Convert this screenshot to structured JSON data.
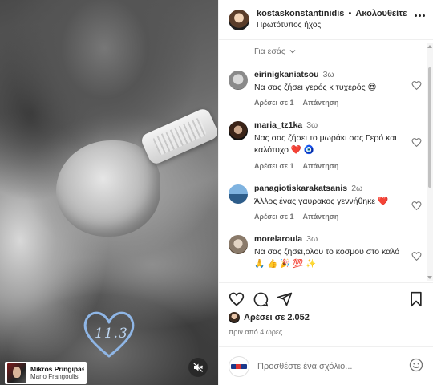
{
  "media": {
    "heart_text": "11.3",
    "music": {
      "song": "Mikros Pringipas",
      "artist": "Mario Frangoulis"
    },
    "mute_icon": "speaker-muted-icon"
  },
  "header": {
    "username": "kostaskonstantinidis",
    "separator": "•",
    "follow_label": "Ακολουθείτε",
    "audio_label": "Πρωτότυπος ήχος",
    "more_icon": "more-options-icon"
  },
  "for_you": {
    "label": "Για εσάς",
    "icon": "chevron-down-icon"
  },
  "comments": [
    {
      "username": "eirinigkaniatsou",
      "time": "3ω",
      "text": "Να σας ζήσει γερός κ τυχερός 😍",
      "like_count": "Αρέσει σε 1",
      "reply_label": "Απάντηση"
    },
    {
      "username": "maria_tz1ka",
      "time": "3ω",
      "text": "Νας σας ζήσει το μωράκι σας Γερό και καλότυχο ❤️ 🧿",
      "like_count": "Αρέσει σε 1",
      "reply_label": "Απάντηση"
    },
    {
      "username": "panagiotiskarakatsanis",
      "time": "2ω",
      "text": "Άλλος ένας γαυρακος γεννήθηκε ❤️",
      "like_count": "Αρέσει σε 1",
      "reply_label": "Απάντηση"
    },
    {
      "username": "morelaroula",
      "time": "3ω",
      "text": "Να σας ζησει,ολου το κοσμου στο καλό 🙏 👍 🎉 💯 ✨",
      "like_count": "",
      "reply_label": ""
    }
  ],
  "actions": {
    "like_icon": "heart-outline-icon",
    "comment_icon": "comment-bubble-icon",
    "share_icon": "paper-plane-icon",
    "save_icon": "bookmark-icon"
  },
  "likes": {
    "label": "Αρέσει σε 2.052"
  },
  "timestamp": "πριν από 4 ώρες",
  "add_comment": {
    "placeholder": "Προσθέστε ένα σχόλιο...",
    "emoji_icon": "smiley-icon"
  }
}
